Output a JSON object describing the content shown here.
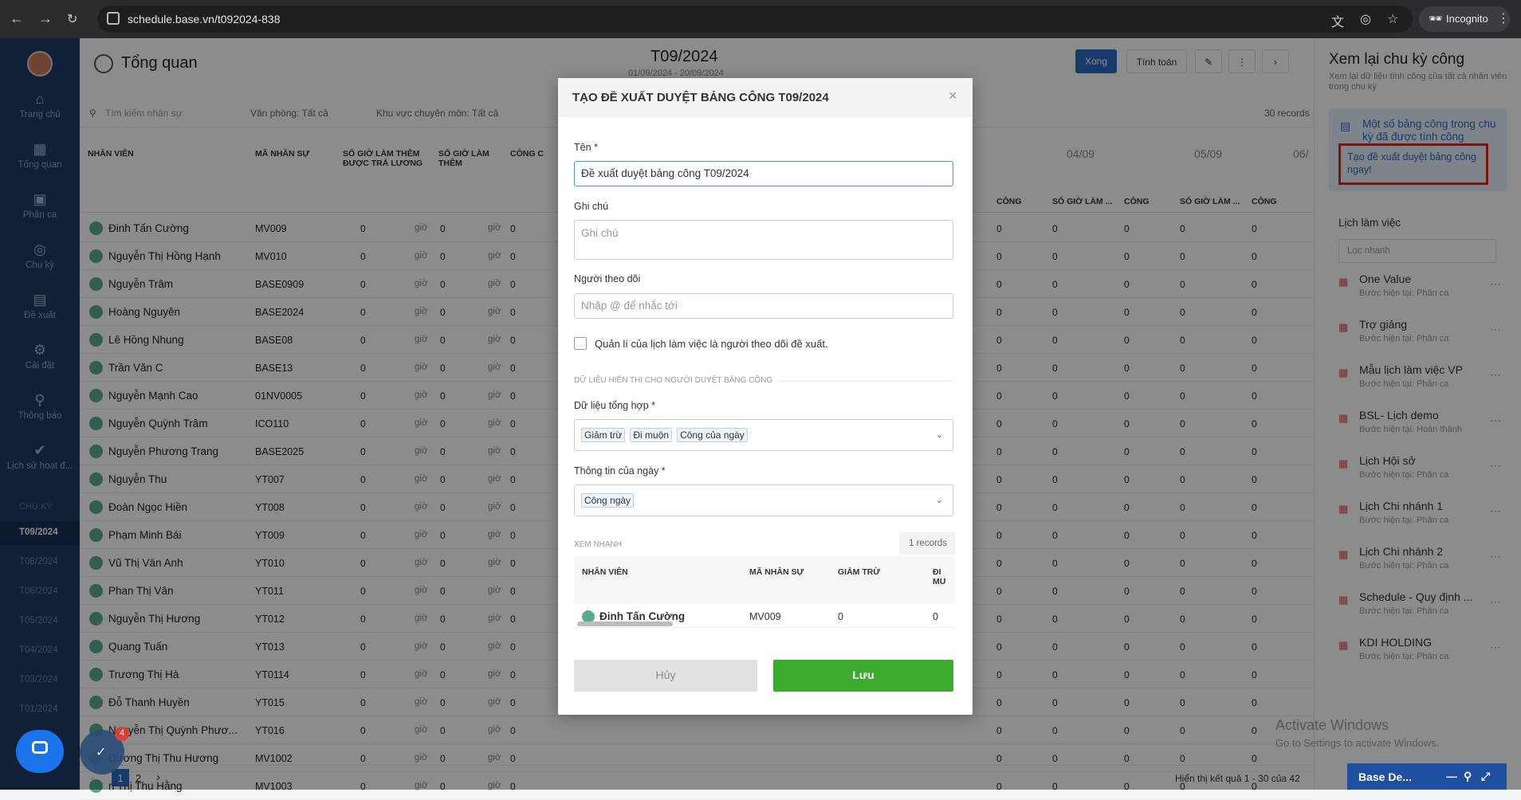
{
  "browser": {
    "url": "schedule.base.vn/t092024-838",
    "incognito_label": "Incognito"
  },
  "sidebar": {
    "items": [
      {
        "label": "Trang chủ",
        "icon": "home-icon"
      },
      {
        "label": "Tổng quan",
        "icon": "grid-icon"
      },
      {
        "label": "Phân ca",
        "icon": "calendar-edit-icon"
      },
      {
        "label": "Chu kỳ",
        "icon": "cycle-icon"
      },
      {
        "label": "Đề xuất",
        "icon": "document-icon"
      },
      {
        "label": "Cài đặt",
        "icon": "gear-icon"
      },
      {
        "label": "Thông báo",
        "icon": "bell-icon"
      },
      {
        "label": "Lịch sử hoạt đ...",
        "icon": "check-circle-icon"
      }
    ],
    "section_label": "CHU KỲ",
    "periods": [
      "T09/2024",
      "T08/2024",
      "T06/2024",
      "T05/2024",
      "T04/2024",
      "T03/2024",
      "T01/2024"
    ],
    "chat_badge": "4"
  },
  "page": {
    "title": "Tổng quan",
    "period_title": "T09/2024",
    "period_range": "01/09/2024 - 20/09/2024",
    "btn_done": "Xong",
    "btn_calc": "Tính toán",
    "search_placeholder": "Tìm kiếm nhân sự",
    "filter_office": "Văn phòng: Tất cả",
    "filter_area": "Khu vực chuyên môn: Tất cả",
    "records": "30 records",
    "columns": [
      "NHÂN VIÊN",
      "MÃ NHÂN SỰ",
      "SỐ GIỜ LÀM THÊM ĐƯỢC TRẢ LƯƠNG",
      "SỐ GIỜ LÀM THÊM",
      "CÔNG C"
    ],
    "date_cols": [
      "04/09",
      "05/09",
      "06/"
    ],
    "sub_cols": [
      "CÔNG",
      "SỐ GIỜ LÀM ...",
      "CÔNG",
      "SỐ GIỜ LÀM ...",
      "CÔNG"
    ],
    "unit": "giờ",
    "zero": "0",
    "rows": [
      {
        "name": "Đinh Tấn Cường",
        "code": "MV009"
      },
      {
        "name": "Nguyễn Thị Hồng Hạnh",
        "code": "MV010"
      },
      {
        "name": "Nguyễn Trâm",
        "code": "BASE0909"
      },
      {
        "name": "Hoàng Nguyên",
        "code": "BASE2024"
      },
      {
        "name": "Lê Hồng Nhung",
        "code": "BASE08"
      },
      {
        "name": "Trần Văn C",
        "code": "BASE13"
      },
      {
        "name": "Nguyễn Mạnh Cao",
        "code": "01NV0005"
      },
      {
        "name": "Nguyễn Quỳnh Trâm",
        "code": "ICO110"
      },
      {
        "name": "Nguyễn Phương Trang",
        "code": "BASE2025"
      },
      {
        "name": "Nguyễn Thu",
        "code": "YT007"
      },
      {
        "name": "Đoàn Ngọc Hiền",
        "code": "YT008"
      },
      {
        "name": "Phạm Minh Bái",
        "code": "YT009"
      },
      {
        "name": "Vũ Thị Vân Anh",
        "code": "YT010"
      },
      {
        "name": "Phan Thị Vân",
        "code": "YT011"
      },
      {
        "name": "Nguyễn Thị Hương",
        "code": "YT012"
      },
      {
        "name": "Quang Tuấn",
        "code": "YT013"
      },
      {
        "name": "Trương Thị Hà",
        "code": "YT0114"
      },
      {
        "name": "Đỗ Thanh Huyền",
        "code": "YT015"
      },
      {
        "name": "Nguyễn Thị Quỳnh Phươ...",
        "code": "YT016"
      },
      {
        "name": "Dương Thị Thu Hương",
        "code": "MV1002"
      },
      {
        "name": "n Thị Thu Hằng",
        "code": "MV1003"
      }
    ],
    "pager_pages": [
      "1",
      "2"
    ],
    "pager_summary": "Hiển thị kết quả 1 - 30 của 42"
  },
  "right_panel": {
    "title": "Xem lại chu kỳ công",
    "subtitle": "Xem lại dữ liệu tính công của tất cả nhân viên trong chu kỳ",
    "card_text": "Một số bảng công trong chu kỳ đã được tính công",
    "highlight_text": "Tạo đề xuất duyệt bảng công ngay!",
    "calendar_label": "Lịch làm việc",
    "filter_placeholder": "Lọc nhanh",
    "calendars": [
      {
        "name": "One Value",
        "status": "Bước hiện tại: Phân ca"
      },
      {
        "name": "Trợ giảng",
        "status": "Bước hiện tại: Phân ca"
      },
      {
        "name": "Mẫu lịch làm việc VP",
        "status": "Bước hiện tại: Phân ca"
      },
      {
        "name": "BSL- Lịch demo",
        "status": "Bước hiện tại: Hoàn thành"
      },
      {
        "name": "Lịch Hội sở",
        "status": "Bước hiện tại: Phân ca"
      },
      {
        "name": "Lịch Chi nhánh 1",
        "status": "Bước hiện tại: Phân ca"
      },
      {
        "name": "Lịch Chi nhánh 2",
        "status": "Bước hiện tại: Phân ca"
      },
      {
        "name": "Schedule - Quy định ...",
        "status": "Bước hiện tại: Phân ca"
      },
      {
        "name": "KDI HOLDING",
        "status": "Bước hiện tại: Phân ca"
      }
    ],
    "mini_bar": "Base De..."
  },
  "watermark": {
    "line1": "Activate Windows",
    "line2": "Go to Settings to activate Windows."
  },
  "modal": {
    "title": "TẠO ĐỀ XUẤT DUYỆT BẢNG CÔNG T09/2024",
    "name_label": "Tên *",
    "name_value": "Đề xuất duyệt bảng công T09/2024",
    "note_label": "Ghi chú",
    "note_placeholder": "Ghi chú",
    "follower_label": "Người theo dõi",
    "follower_placeholder": "Nhập @ để nhắc tới",
    "checkbox_label": "Quản lí của lịch làm việc là người theo dõi đề xuất.",
    "section_label": "DỮ LIỆU HIỂN THỊ CHO NGƯỜI DUYỆT BẢNG CÔNG",
    "summary_label": "Dữ liệu tổng hợp *",
    "summary_tags": [
      "Giảm trừ",
      "Đi muộn",
      "Công của ngày"
    ],
    "day_label": "Thông tin của ngày *",
    "day_tags": [
      "Công ngày"
    ],
    "preview_label": "XEM NHANH",
    "preview_records": "1 records",
    "preview_columns": [
      "NHÂN VIÊN",
      "MÃ NHÂN SỰ",
      "GIẢM TRỪ",
      "ĐI MU"
    ],
    "preview_row": {
      "name": "Đinh Tấn Cường",
      "code": "MV009",
      "giam_tru": "0",
      "di_muon": "0"
    },
    "cancel_label": "Hủy",
    "save_label": "Lưu"
  },
  "colors": {
    "primary": "#2b68c5",
    "save": "#3dab2f",
    "sidebar": "#203a64",
    "highlight": "#e02424"
  }
}
